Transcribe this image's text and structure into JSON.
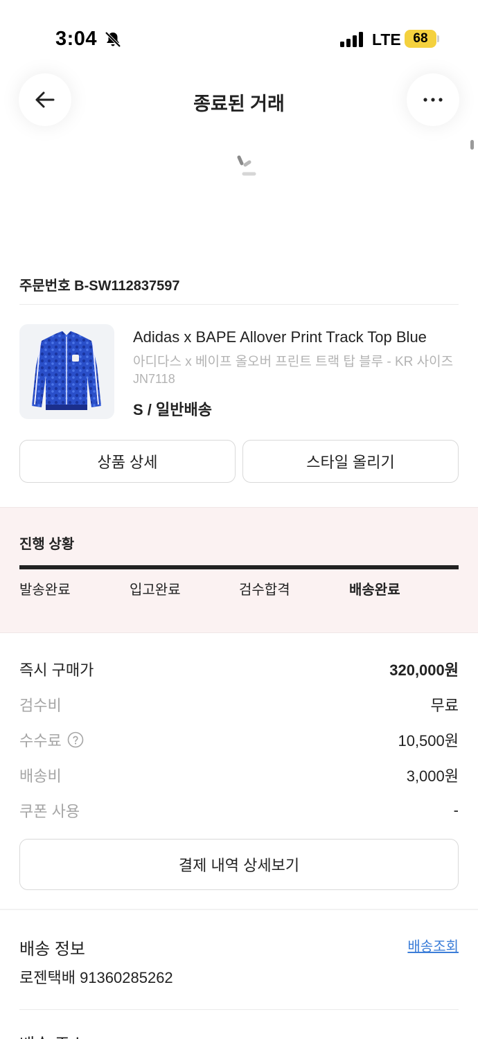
{
  "status_bar": {
    "time": "3:04",
    "network": "LTE",
    "battery": "68"
  },
  "header": {
    "title": "종료된 거래"
  },
  "order": {
    "number_label": "주문번호 B-SW112837597"
  },
  "product": {
    "name": "Adidas x BAPE Allover Print Track Top Blue",
    "name_ko": "아디다스 x 베이프 올오버 프린트 트랙 탑 블루 - KR 사이즈",
    "code": "JN7118",
    "option": "S / 일반배송"
  },
  "actions": {
    "detail_label": "상품 상세",
    "style_label": "스타일 올리기"
  },
  "progress": {
    "title": "진행 상황",
    "steps": [
      {
        "label": "발송완료"
      },
      {
        "label": "입고완료"
      },
      {
        "label": "검수합격"
      },
      {
        "label": "배송완료"
      }
    ],
    "current_step": 4
  },
  "price": {
    "rows": [
      {
        "label": "즉시 구매가",
        "value": "320,000원"
      },
      {
        "label": "검수비",
        "value": "무료"
      },
      {
        "label": "수수료",
        "value": "10,500원"
      },
      {
        "label": "배송비",
        "value": "3,000원"
      },
      {
        "label": "쿠폰 사용",
        "value": "-"
      }
    ],
    "history_button": "결제 내역 상세보기"
  },
  "delivery": {
    "title": "배송 정보",
    "link": "배송조회",
    "tracking": "로젠택배 91360285262"
  },
  "next_section": {
    "title": "배송 주소"
  },
  "colors": {
    "accent_link": "#3b7dd8",
    "progress_bg": "#fbf2f2",
    "battery": "#f4d13e"
  },
  "icons": [
    "bell-slash-icon",
    "signal-icon",
    "back-arrow-icon",
    "more-dots-icon",
    "loading-spinner-icon",
    "question-circle-icon"
  ]
}
